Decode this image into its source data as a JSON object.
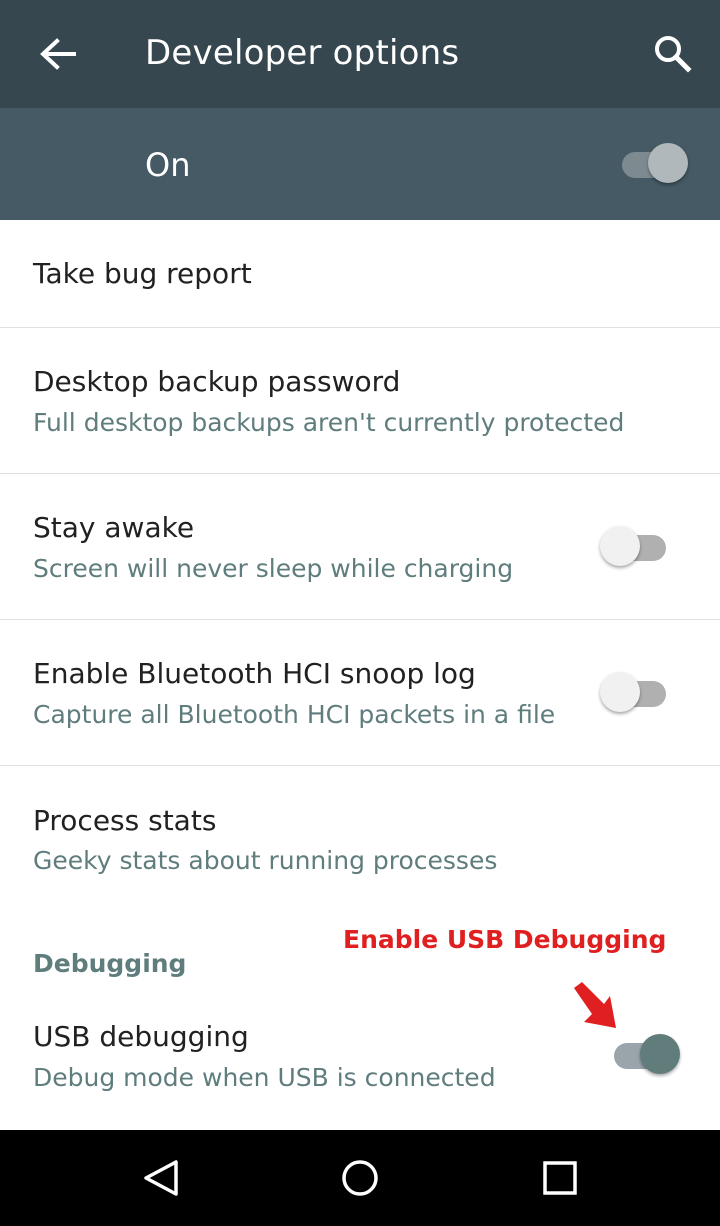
{
  "app_bar": {
    "title": "Developer options",
    "back_icon": "arrow-back-icon",
    "search_icon": "search-icon"
  },
  "master_switch": {
    "label": "On",
    "state": "on"
  },
  "settings": [
    {
      "title": "Take bug report"
    },
    {
      "title": "Desktop backup password",
      "subtitle": "Full desktop backups aren't currently protected"
    },
    {
      "title": "Stay awake",
      "subtitle": "Screen will never sleep while charging",
      "switch": "off"
    },
    {
      "title": "Enable Bluetooth HCI snoop log",
      "subtitle": "Capture all Bluetooth HCI packets in a file",
      "switch": "off"
    },
    {
      "title": "Process stats",
      "subtitle": "Geeky stats about running processes"
    }
  ],
  "debugging_section": {
    "header": "Debugging",
    "usb_debugging": {
      "title": "USB debugging",
      "subtitle": "Debug mode when USB is connected",
      "switch": "on"
    }
  },
  "annotation": {
    "text": "Enable USB Debugging",
    "color": "#e02020"
  },
  "nav_bar": {
    "back_icon": "triangle-back-icon",
    "home_icon": "circle-home-icon",
    "recents_icon": "square-recents-icon"
  },
  "colors": {
    "app_bar": "#37474f",
    "master_bar": "#455a64",
    "accent": "#607d7b",
    "subtitle": "#607d7e"
  }
}
